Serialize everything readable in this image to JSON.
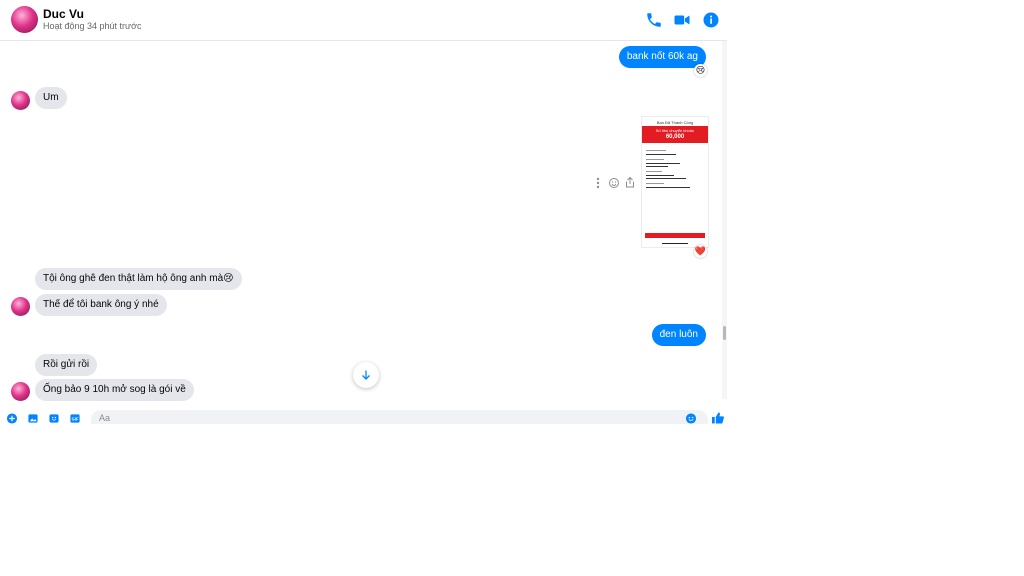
{
  "header": {
    "name": "Duc Vu",
    "status": "Hoạt động 34 phút trước",
    "accent_color": "#0084ff"
  },
  "messages": [
    {
      "side": "out",
      "text": "bank nốt 60k ag",
      "reaction": "😢"
    },
    {
      "side": "in",
      "text": "Um"
    },
    {
      "side": "out",
      "type": "image",
      "reaction": "❤️",
      "image": {
        "title": "Bạn Đã Thanh Công",
        "label": "Số tiền chuyển khoản",
        "amount": "60,000"
      }
    },
    {
      "side": "in",
      "text": "Tội ông ghê đen thật làm hộ ông anh mà😢"
    },
    {
      "side": "in",
      "text": "Thế để tôi bank ông ý nhé"
    },
    {
      "side": "out",
      "text": "đen luôn"
    },
    {
      "side": "in",
      "text": "Rồi gửi rồi"
    },
    {
      "side": "in",
      "text": "Ống bảo 9 10h mở sog là gói về"
    }
  ],
  "composer": {
    "placeholder": "Aa"
  },
  "icons": {
    "call": "phone-icon",
    "video": "video-icon",
    "info": "info-icon",
    "more": "more-actions-icon",
    "add": "plus-circle-icon",
    "photo": "photo-icon",
    "sticker": "sticker-icon",
    "gif": "gif-icon",
    "emoji": "emoji-icon",
    "like": "thumbs-up-icon",
    "scroll_down": "arrow-down-icon"
  }
}
